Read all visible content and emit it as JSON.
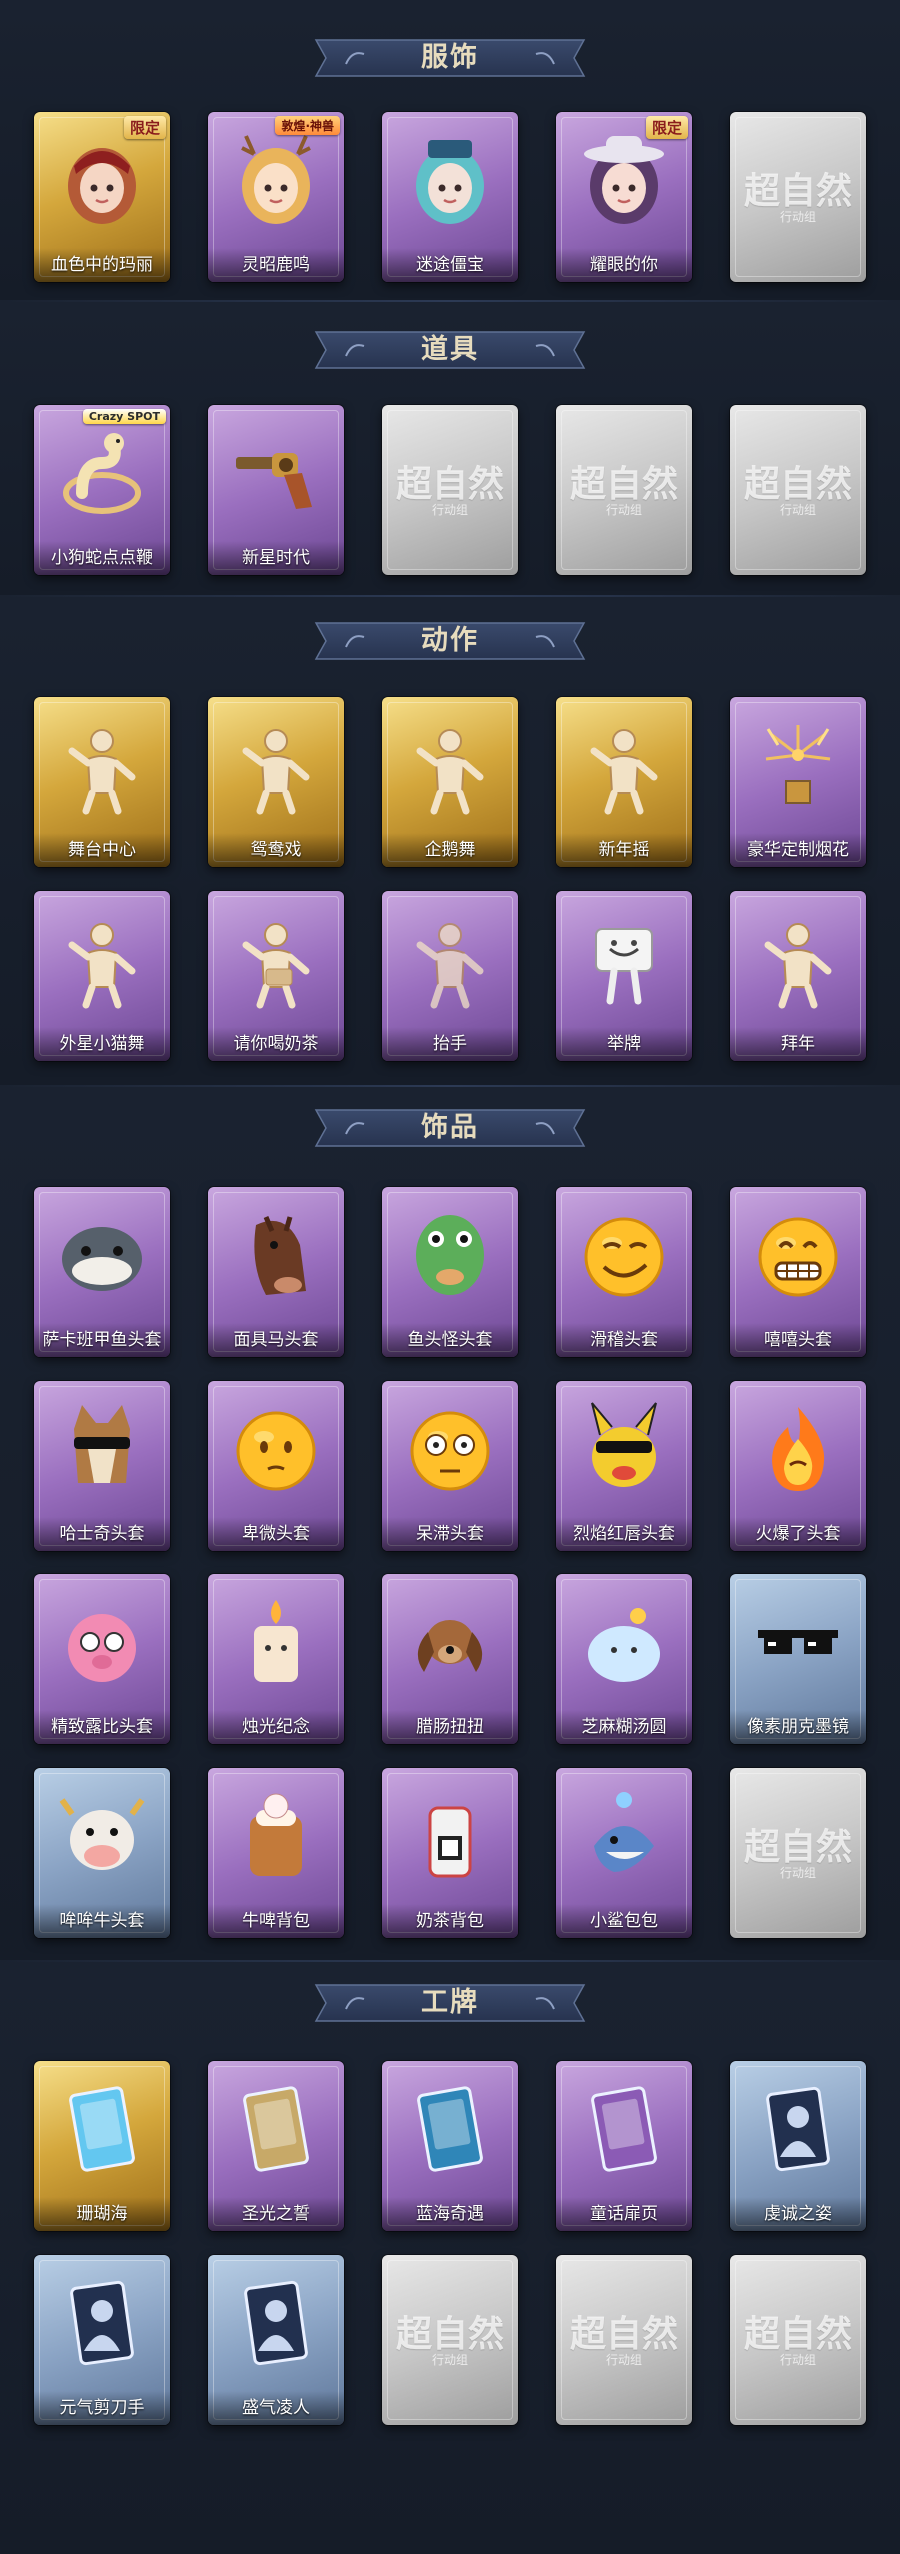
{
  "watermark": {
    "main": "超自然",
    "sub": "行动组"
  },
  "sections": [
    {
      "title": "服饰",
      "rows": [
        [
          {
            "label": "血色中的玛丽",
            "rarity": "gold",
            "icon": "portrait-mary-icon",
            "badge": "限定"
          },
          {
            "label": "灵昭鹿鸣",
            "rarity": "purple",
            "icon": "portrait-deer-icon",
            "badge": "敦煌·神兽"
          },
          {
            "label": "迷途僵宝",
            "rarity": "purple",
            "icon": "portrait-jiangshi-icon"
          },
          {
            "label": "耀眼的你",
            "rarity": "purple",
            "icon": "portrait-cowgirl-icon",
            "badge": "限定"
          },
          {
            "label": "",
            "rarity": "gray",
            "icon": "placeholder-icon"
          }
        ]
      ]
    },
    {
      "title": "道具",
      "rows": [
        [
          {
            "label": "小狗蛇点点鞭",
            "rarity": "purple",
            "icon": "snake-whip-icon",
            "badge": "Crazy SPOT"
          },
          {
            "label": "新星时代",
            "rarity": "purple",
            "icon": "revolver-icon"
          },
          {
            "label": "",
            "rarity": "gray",
            "icon": "placeholder-icon"
          },
          {
            "label": "",
            "rarity": "gray",
            "icon": "placeholder-icon"
          },
          {
            "label": "",
            "rarity": "gray",
            "icon": "placeholder-icon"
          }
        ]
      ]
    },
    {
      "title": "动作",
      "rows": [
        [
          {
            "label": "舞台中心",
            "rarity": "gold",
            "icon": "dance-pose-icon"
          },
          {
            "label": "鸳鸯戏",
            "rarity": "gold",
            "icon": "dance-pose-icon"
          },
          {
            "label": "企鹅舞",
            "rarity": "gold",
            "icon": "dance-pose-icon"
          },
          {
            "label": "新年摇",
            "rarity": "gold",
            "icon": "dance-pose-icon"
          },
          {
            "label": "豪华定制烟花",
            "rarity": "purple",
            "icon": "firework-icon"
          }
        ],
        [
          {
            "label": "外星小猫舞",
            "rarity": "purple",
            "icon": "dance-pose-icon"
          },
          {
            "label": "请你喝奶茶",
            "rarity": "purple",
            "icon": "gesture-icon"
          },
          {
            "label": "抬手",
            "rarity": "purple",
            "icon": "wave-hand-icon"
          },
          {
            "label": "举牌",
            "rarity": "purple",
            "icon": "hold-sign-icon"
          },
          {
            "label": "拜年",
            "rarity": "purple",
            "icon": "bow-pose-icon"
          }
        ]
      ]
    },
    {
      "title": "饰品",
      "rows": [
        [
          {
            "label": "萨卡班甲鱼头套",
            "rarity": "purple",
            "icon": "fish-head-icon"
          },
          {
            "label": "面具马头套",
            "rarity": "purple",
            "icon": "horse-head-icon"
          },
          {
            "label": "鱼头怪头套",
            "rarity": "purple",
            "icon": "frog-fish-head-icon"
          },
          {
            "label": "滑稽头套",
            "rarity": "purple",
            "icon": "smirk-emoji-icon"
          },
          {
            "label": "嘻嘻头套",
            "rarity": "purple",
            "icon": "grin-emoji-icon"
          }
        ],
        [
          {
            "label": "哈士奇头套",
            "rarity": "purple",
            "icon": "husky-head-icon"
          },
          {
            "label": "卑微头套",
            "rarity": "purple",
            "icon": "shy-emoji-icon"
          },
          {
            "label": "呆滞头套",
            "rarity": "purple",
            "icon": "blank-emoji-icon"
          },
          {
            "label": "烈焰红唇头套",
            "rarity": "purple",
            "icon": "pikachu-head-icon"
          },
          {
            "label": "火爆了头套",
            "rarity": "purple",
            "icon": "fire-emoji-icon"
          }
        ],
        [
          {
            "label": "精致露比头套",
            "rarity": "purple",
            "icon": "pink-pig-head-icon"
          },
          {
            "label": "烛光纪念",
            "rarity": "purple",
            "icon": "candle-icon"
          },
          {
            "label": "腊肠扭扭",
            "rarity": "purple",
            "icon": "dachshund-icon"
          },
          {
            "label": "芝麻糊汤圆",
            "rarity": "purple",
            "icon": "tangyuan-icon"
          },
          {
            "label": "像素朋克墨镜",
            "rarity": "blue",
            "icon": "pixel-sunglasses-icon"
          }
        ],
        [
          {
            "label": "哞哞牛头套",
            "rarity": "blue",
            "icon": "cow-head-icon"
          },
          {
            "label": "牛啤背包",
            "rarity": "purple",
            "icon": "beer-backpack-icon"
          },
          {
            "label": "奶茶背包",
            "rarity": "purple",
            "icon": "milktea-backpack-icon"
          },
          {
            "label": "小鲨包包",
            "rarity": "purple",
            "icon": "shark-bag-icon"
          },
          {
            "label": "",
            "rarity": "gray",
            "icon": "placeholder-icon"
          }
        ]
      ]
    },
    {
      "title": "工牌",
      "rows": [
        [
          {
            "label": "珊瑚海",
            "rarity": "gold",
            "icon": "badge-card-icon"
          },
          {
            "label": "圣光之誓",
            "rarity": "purple",
            "icon": "badge-card-icon"
          },
          {
            "label": "蓝海奇遇",
            "rarity": "purple",
            "icon": "badge-card-icon"
          },
          {
            "label": "童话扉页",
            "rarity": "purple",
            "icon": "badge-card-icon"
          },
          {
            "label": "虔诚之姿",
            "rarity": "blue",
            "icon": "silhouette-card-icon"
          }
        ],
        [
          {
            "label": "元气剪刀手",
            "rarity": "blue",
            "icon": "silhouette-card-icon"
          },
          {
            "label": "盛气凌人",
            "rarity": "blue",
            "icon": "silhouette-card-icon"
          },
          {
            "label": "",
            "rarity": "gray",
            "icon": "placeholder-icon"
          },
          {
            "label": "",
            "rarity": "gray",
            "icon": "placeholder-icon"
          },
          {
            "label": "",
            "rarity": "gray",
            "icon": "placeholder-icon"
          }
        ]
      ]
    }
  ]
}
